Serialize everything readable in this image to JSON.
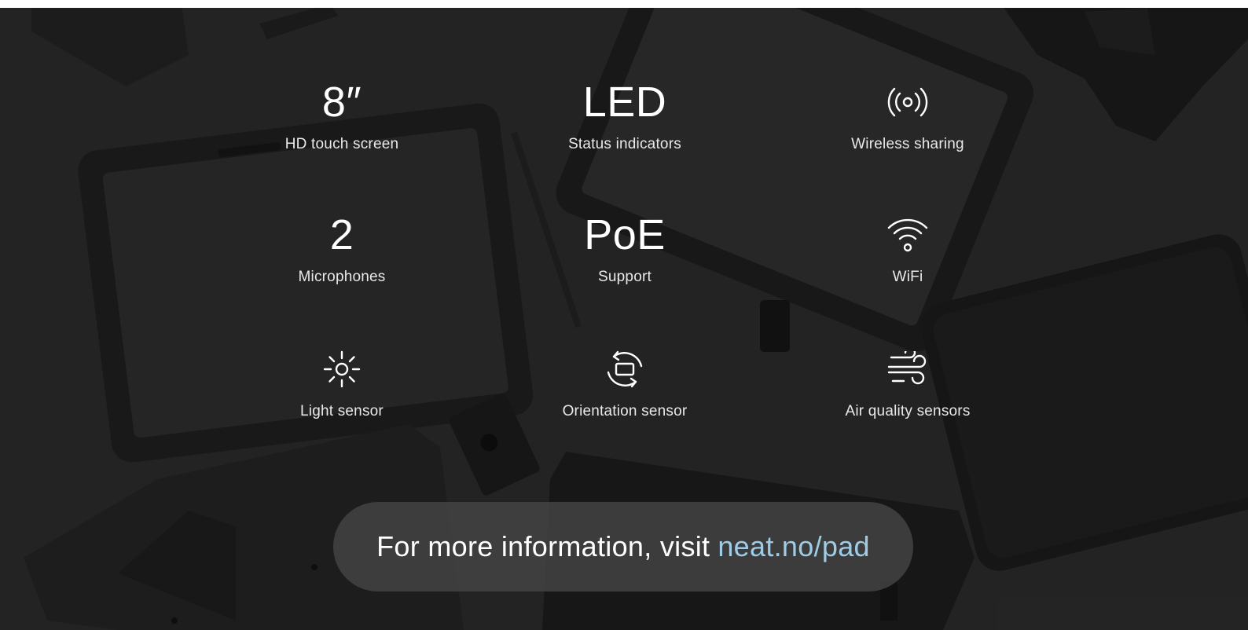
{
  "features": [
    {
      "value": "8″",
      "label": "HD touch screen"
    },
    {
      "value": "LED",
      "label": "Status indicators"
    },
    {
      "icon": "wireless-sharing-icon",
      "label": "Wireless sharing"
    },
    {
      "value": "2",
      "label": "Microphones"
    },
    {
      "value": "PoE",
      "label": "Support"
    },
    {
      "icon": "wifi-icon",
      "label": "WiFi"
    },
    {
      "icon": "sun-icon",
      "label": "Light sensor"
    },
    {
      "icon": "rotate-icon",
      "label": "Orientation sensor"
    },
    {
      "icon": "wind-icon",
      "label": "Air quality sensors"
    }
  ],
  "cta": {
    "text": "For more information, visit",
    "link_text": "neat.no/pad"
  },
  "colors": {
    "background": "#2b2b2b",
    "link": "#9fcbe6",
    "pill": "#464646"
  }
}
